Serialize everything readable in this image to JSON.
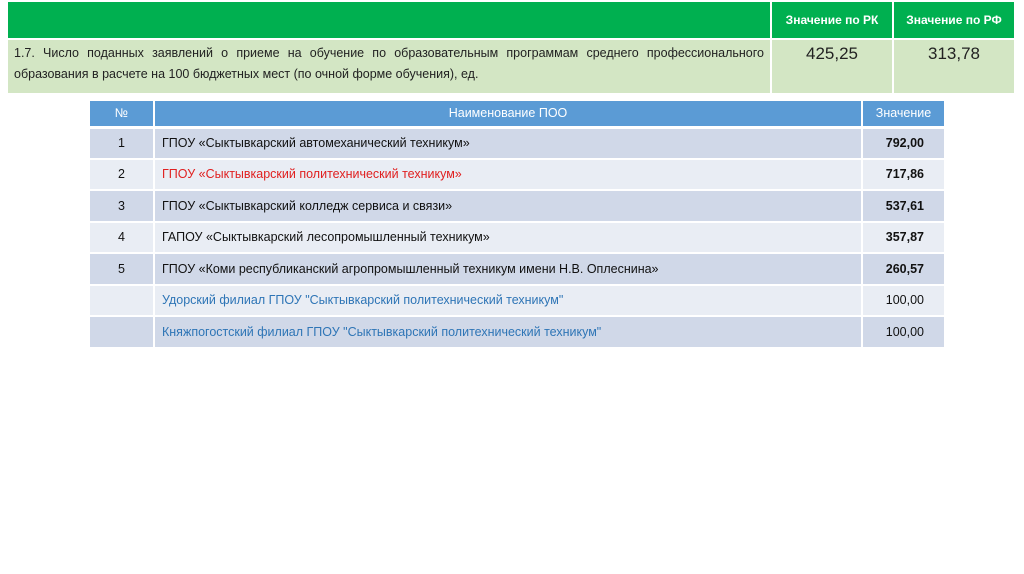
{
  "summary": {
    "headers": [
      "Значение по РК",
      "Значение по РФ"
    ],
    "indicator": "1.7. Число поданных заявлений о приеме на обучение по образовательным программам среднего профессионального образования в расчете на 100 бюджетных мест (по очной форме обучения), ед.",
    "value_rk": "425,25",
    "value_rf": "313,78"
  },
  "table": {
    "headers": [
      "№",
      "Наименование ПОО",
      "Значение"
    ],
    "rows": [
      {
        "num": "1",
        "name": "ГПОУ «Сыктывкарский автомеханический техникум»",
        "value": "792,00"
      },
      {
        "num": "2",
        "name": "ГПОУ «Сыктывкарский политехнический техникум»",
        "value": "717,86"
      },
      {
        "num": "3",
        "name": "ГПОУ «Сыктывкарский колледж сервиса и связи»",
        "value": "537,61"
      },
      {
        "num": "4",
        "name": "ГАПОУ «Сыктывкарский лесопромышленный техникум»",
        "value": "357,87"
      },
      {
        "num": "5",
        "name": "ГПОУ «Коми республиканский  агропромышленный техникум имени Н.В. Оплеснина»",
        "value": "260,57"
      },
      {
        "num": "",
        "name": "Удорский филиал ГПОУ  \"Сыктывкарский политехнический техникум\"",
        "value": "100,00"
      },
      {
        "num": "",
        "name": "Княжпогостский филиал ГПОУ  \"Сыктывкарский политехнический техникум\"",
        "value": "100,00"
      }
    ]
  },
  "colors": {
    "green": "#00b050",
    "light_green": "#d3e6c4",
    "blue": "#5b9bd5",
    "red": "#e02020",
    "link_blue": "#2e75b6"
  }
}
